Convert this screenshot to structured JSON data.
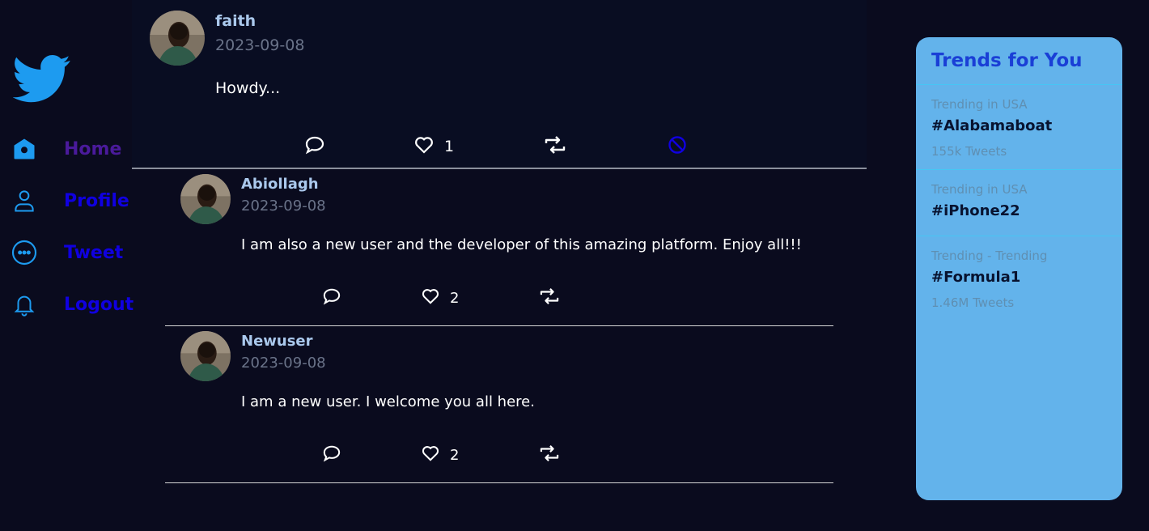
{
  "colors": {
    "background": "#0a0b1e",
    "nav_active": "#4a1a9b",
    "nav_link": "#1000e0",
    "icon_blue": "#1d9bf0",
    "trends_bg": "#63b3eb",
    "trends_title": "#1a3fd6"
  },
  "sidebar": {
    "logo_icon": "twitter-bird-icon",
    "items": [
      {
        "label": "Home",
        "icon": "home-icon",
        "active": true
      },
      {
        "label": "Profile",
        "icon": "user-icon",
        "active": false
      },
      {
        "label": "Tweet",
        "icon": "more-icon",
        "active": false
      },
      {
        "label": "Logout",
        "icon": "bell-icon",
        "active": false
      }
    ]
  },
  "feed": {
    "main_tweet": {
      "name": "faith",
      "date": "2023-09-08",
      "text": "Howdy...",
      "likes": "1",
      "actions": [
        "comment-icon",
        "heart-icon",
        "retweet-icon",
        "block-icon"
      ]
    },
    "replies": [
      {
        "name": "Abiollagh",
        "date": "2023-09-08",
        "text": "I am also a new user and the developer of this amazing platform. Enjoy all!!!",
        "likes": "2"
      },
      {
        "name": "Newuser",
        "date": "2023-09-08",
        "text": "I am a new user. I welcome you all here.",
        "likes": "2"
      }
    ]
  },
  "trends": {
    "title": "Trends for You",
    "items": [
      {
        "meta": "Trending in USA",
        "tag": "#Alabamaboat",
        "count": "155k Tweets"
      },
      {
        "meta": "Trending in USA",
        "tag": "#iPhone22",
        "count": ""
      },
      {
        "meta": "Trending - Trending",
        "tag": "#Formula1",
        "count": "1.46M Tweets"
      }
    ]
  }
}
